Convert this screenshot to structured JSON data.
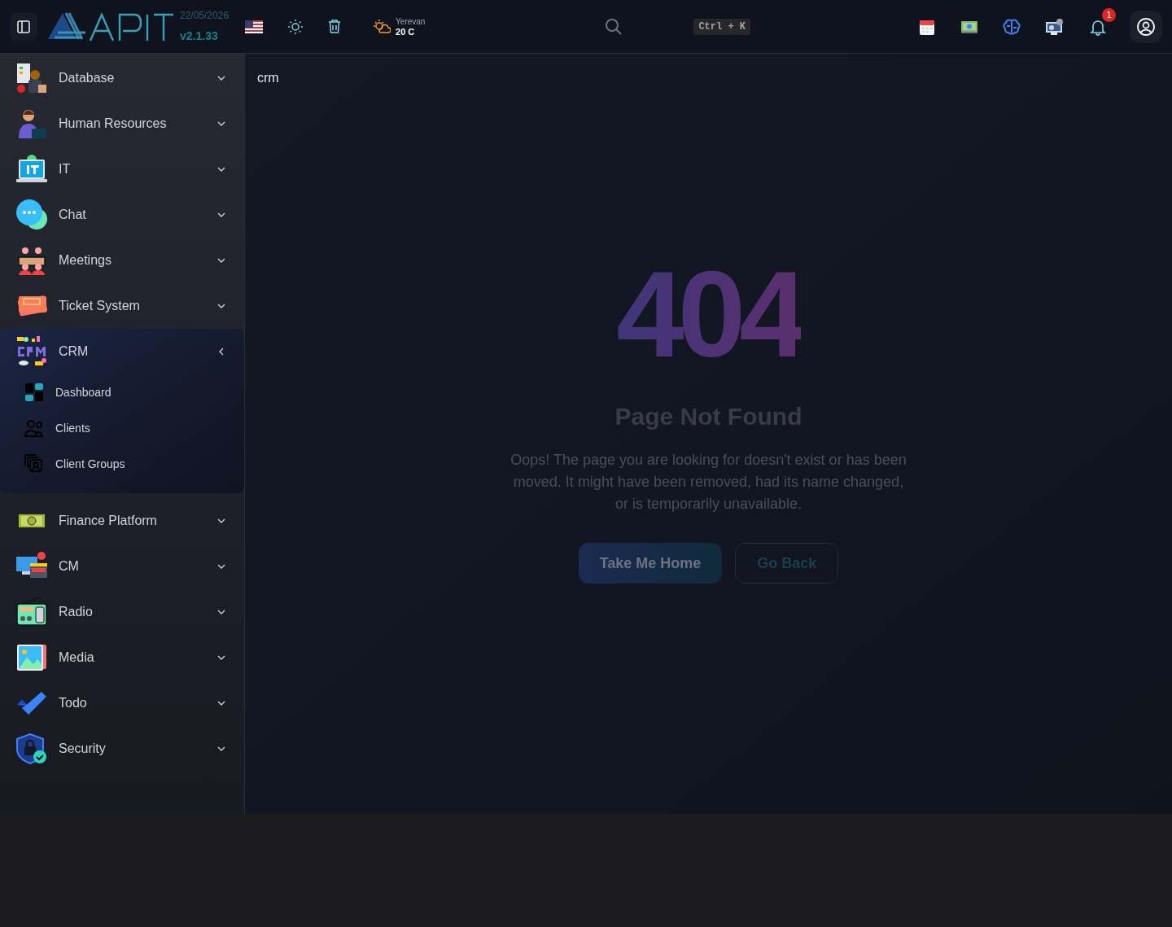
{
  "header": {
    "date": "22/05/2026",
    "version": "v2.1.33",
    "weather": {
      "city": "Yerevan",
      "temperature": "20 C"
    },
    "search_shortcut": "Ctrl + K",
    "notifications": "1"
  },
  "sidebar": {
    "items": [
      {
        "label": "Database",
        "expanded": false
      },
      {
        "label": "Human Resources",
        "expanded": false
      },
      {
        "label": "IT",
        "expanded": false
      },
      {
        "label": "Chat",
        "expanded": false
      },
      {
        "label": "Meetings",
        "expanded": false
      },
      {
        "label": "Ticket System",
        "expanded": false
      },
      {
        "label": "CRM",
        "expanded": true,
        "children": [
          {
            "label": "Dashboard"
          },
          {
            "label": "Clients"
          },
          {
            "label": "Client Groups"
          }
        ]
      },
      {
        "label": "Finance Platform",
        "expanded": false
      },
      {
        "label": "CM",
        "expanded": false
      },
      {
        "label": "Radio",
        "expanded": false
      },
      {
        "label": "Media",
        "expanded": false
      },
      {
        "label": "Todo",
        "expanded": false
      },
      {
        "label": "Security",
        "expanded": false
      }
    ]
  },
  "breadcrumb": "crm",
  "error": {
    "code": "404",
    "title": "Page Not Found",
    "message": "Oops! The page you are looking for doesn't exist or has been moved. It might have been removed, had its name changed, or is temporarily unavailable.",
    "buttons": [
      "Take Me Home",
      "Go Back"
    ]
  }
}
